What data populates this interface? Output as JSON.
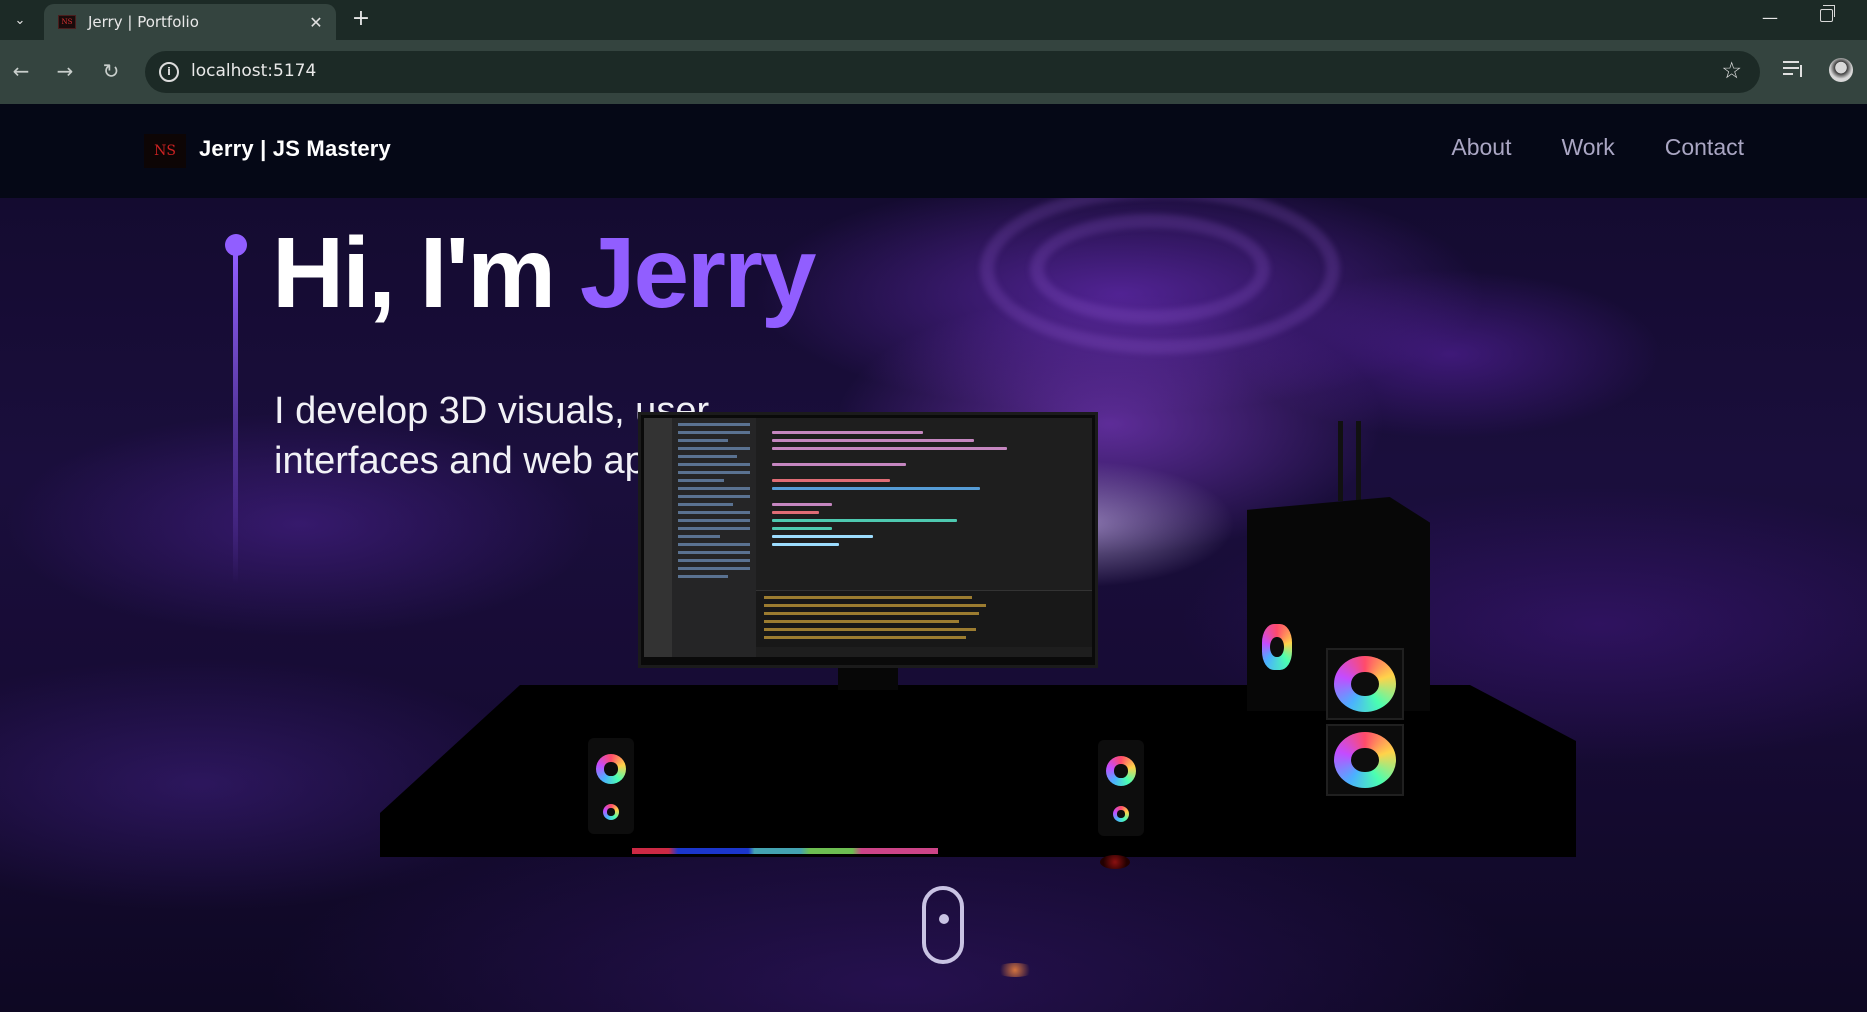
{
  "browser": {
    "tab_title": "Jerry | Portfolio",
    "tab_favicon_text": "NS",
    "url": "localhost:5174",
    "icons": {
      "tab_menu": "chevron-down-icon",
      "tab_close": "close-icon",
      "new_tab": "plus-icon",
      "minimize": "minimize-icon",
      "restore": "restore-icon",
      "back": "arrow-left-icon",
      "forward": "arrow-right-icon",
      "reload": "reload-icon",
      "site_info": "info-icon",
      "bookmark": "star-icon",
      "media": "media-control-icon",
      "profile": "avatar"
    },
    "glyphs": {
      "tab_menu": "⌄",
      "tab_close": "✕",
      "new_tab": "+",
      "minimize": "—",
      "back": "←",
      "forward": "→",
      "reload": "↻",
      "site_info": "i",
      "star": "☆"
    }
  },
  "navbar": {
    "logo_text": "NS",
    "brand": "Jerry  | JS Mastery",
    "links": [
      "About",
      "Work",
      "Contact"
    ]
  },
  "hero": {
    "greeting": "Hi, I'm ",
    "name": "Jerry",
    "subtitle_line1": "I develop 3D visuals, user",
    "subtitle_line2": "interfaces and web applications"
  },
  "colors": {
    "accent": "#915eff",
    "background": "#050816",
    "nav_link": "#aaa6c3",
    "chrome_dark": "#1c2a26",
    "chrome_light": "#34443f"
  }
}
